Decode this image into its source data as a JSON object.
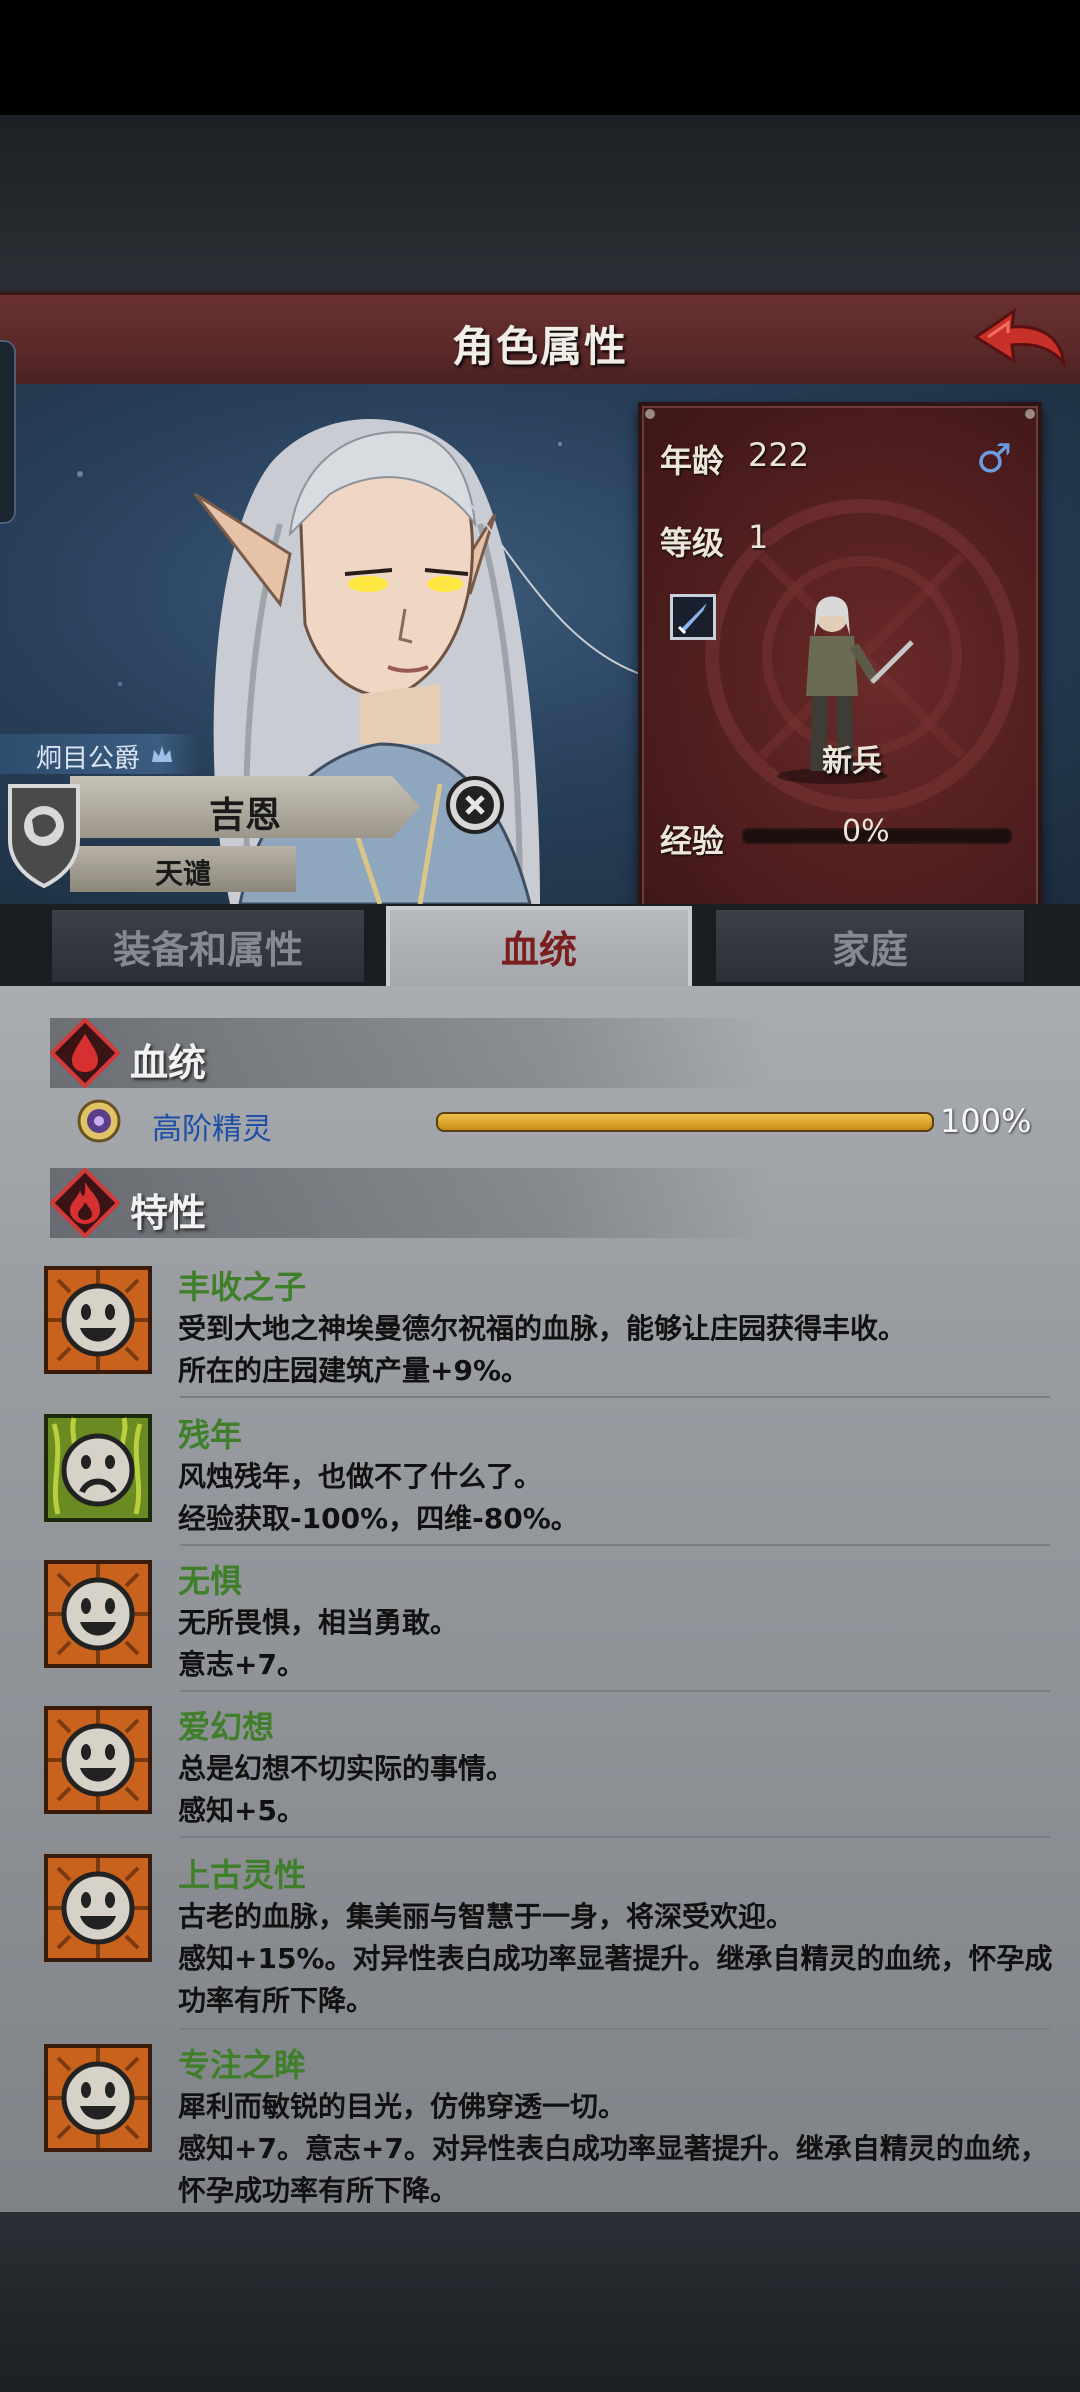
{
  "header": {
    "title": "角色属性"
  },
  "stats": {
    "age_label": "年龄",
    "age_value": "222",
    "level_label": "等级",
    "level_value": "1",
    "gender_icon": "male-icon",
    "class_name": "新兵",
    "exp_label": "经验",
    "exp_percent": "0%",
    "exp_fraction": 0
  },
  "character": {
    "noble_title": "炯目公爵",
    "name": "吉恩",
    "subtitle": "天谴"
  },
  "tabs": [
    {
      "label": "装备和属性",
      "active": false
    },
    {
      "label": "血统",
      "active": true
    },
    {
      "label": "家庭",
      "active": false
    }
  ],
  "bloodline": {
    "section_title": "血统",
    "name": "高阶精灵",
    "percent": "100%",
    "fraction": 1.0
  },
  "traits_section": {
    "title": "特性"
  },
  "traits": [
    {
      "name": "丰收之子",
      "desc1": "受到大地之神埃曼德尔祝福的血脉，能够让庄园获得丰收。",
      "desc2": "所在的庄园建筑产量+9%。",
      "desc3": "",
      "mood": "happy"
    },
    {
      "name": "残年",
      "desc1": "风烛残年，也做不了什么了。",
      "desc2": "经验获取-100%，四维-80%。",
      "desc3": "",
      "mood": "sad"
    },
    {
      "name": "无惧",
      "desc1": "无所畏惧，相当勇敢。",
      "desc2": "意志+7。",
      "desc3": "",
      "mood": "happy"
    },
    {
      "name": "爱幻想",
      "desc1": "总是幻想不切实际的事情。",
      "desc2": "感知+5。",
      "desc3": "",
      "mood": "happy"
    },
    {
      "name": "上古灵性",
      "desc1": "古老的血脉，集美丽与智慧于一身，将深受欢迎。",
      "desc2": "感知+15%。对异性表白成功率显著提升。继承自精灵的血统，怀孕成",
      "desc3": "功率有所下降。",
      "mood": "happy"
    },
    {
      "name": "专注之眸",
      "desc1": "犀利而敏锐的目光，仿佛穿透一切。",
      "desc2": "感知+7。意志+7。对异性表白成功率显著提升。继承自精灵的血统，",
      "desc3": "怀孕成功率有所下降。",
      "mood": "happy"
    }
  ],
  "colors": {
    "accent_red": "#6a3232",
    "trait_green": "#3f7f2a",
    "blood_blue": "#1f4fa6"
  }
}
